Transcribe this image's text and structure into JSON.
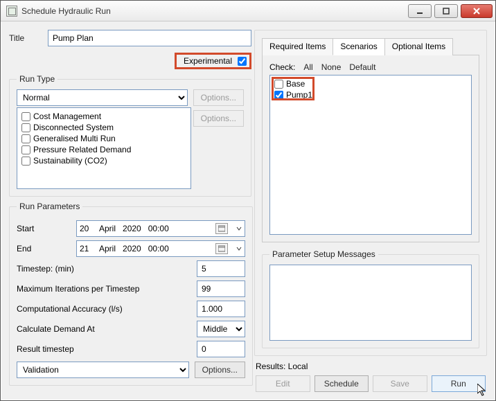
{
  "window": {
    "title": "Schedule Hydraulic Run"
  },
  "title_field": {
    "label": "Title",
    "value": "Pump Plan"
  },
  "experimental": {
    "label": "Experimental",
    "checked": true
  },
  "runtype": {
    "legend": "Run Type",
    "selected": "Normal",
    "options_btn1": "Options...",
    "options_btn2": "Options...",
    "checks": [
      {
        "label": "Cost Management",
        "checked": false
      },
      {
        "label": "Disconnected System",
        "checked": false
      },
      {
        "label": "Generalised Multi Run",
        "checked": false
      },
      {
        "label": "Pressure Related Demand",
        "checked": false
      },
      {
        "label": "Sustainability (CO2)",
        "checked": false
      }
    ]
  },
  "params": {
    "legend": "Run Parameters",
    "start_label": "Start",
    "start": {
      "day": "20",
      "month": "April",
      "year": "2020",
      "time": "00:00"
    },
    "end_label": "End",
    "end": {
      "day": "21",
      "month": "April",
      "year": "2020",
      "time": "00:00"
    },
    "timestep_label": "Timestep: (min)",
    "timestep": "5",
    "maxiter_label": "Maximum Iterations per Timestep",
    "maxiter": "99",
    "accuracy_label": "Computational Accuracy (l/s)",
    "accuracy": "1.000",
    "calcdemand_label": "Calculate Demand At",
    "calcdemand": "Middle",
    "result_ts_label": "Result timestep",
    "result_ts": "0",
    "validation": "Validation",
    "options_btn": "Options..."
  },
  "tabs": {
    "items": [
      "Required Items",
      "Scenarios",
      "Optional Items"
    ],
    "active": 1
  },
  "scenarios": {
    "check_label": "Check:",
    "all": "All",
    "none": "None",
    "default": "Default",
    "items": [
      {
        "label": "Base",
        "checked": false
      },
      {
        "label": "Pump1",
        "checked": true
      }
    ]
  },
  "msgs": {
    "legend": "Parameter Setup Messages"
  },
  "results": {
    "label": "Results: Local",
    "edit": "Edit",
    "schedule": "Schedule",
    "save": "Save",
    "run": "Run"
  }
}
